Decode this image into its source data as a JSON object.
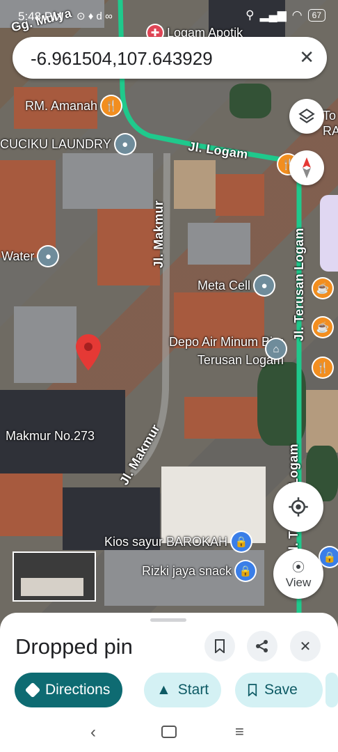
{
  "status_bar": {
    "time": "5:48 PM",
    "indicators": "⊙ ♦ d ∞",
    "battery": "67"
  },
  "search": {
    "query": "-6.961504,107.643929"
  },
  "map": {
    "roads": [
      {
        "label": "Gg. Mulya"
      },
      {
        "label": "Jl. Logam"
      },
      {
        "label": "Jl. Makmur"
      },
      {
        "label": "Jl. Terusan Logam"
      },
      {
        "label": "Jl. Makmur"
      },
      {
        "label": "Jl. Terusan Logam"
      }
    ],
    "pois": [
      {
        "label": "Logam Apotik",
        "icon": "pharmacy-icon",
        "color": "#e04556"
      },
      {
        "label": "RM. Amanah",
        "icon": "restaurant-icon",
        "color": "#f28e1f"
      },
      {
        "label": "CUCIKU LAUNDRY",
        "icon": "place-icon",
        "color": "#6f8c9b"
      },
      {
        "label": "Water",
        "icon": "place-icon",
        "color": "#6f8c9b"
      },
      {
        "label": "Meta Cell",
        "icon": "place-icon",
        "color": "#6f8c9b"
      },
      {
        "label": "Depo Air Minum Biru Terusan Logam",
        "icon": "bank-icon",
        "color": "#6f8c9b"
      },
      {
        "label": "Makmur No.273",
        "icon": "",
        "color": ""
      },
      {
        "label": "Kios sayur BAROKAH",
        "icon": "shopping-icon",
        "color": "#3a7ee8"
      },
      {
        "label": "Rizki jaya snack",
        "icon": "shopping-icon",
        "color": "#3a7ee8"
      },
      {
        "label": "To RA",
        "icon": "",
        "color": ""
      }
    ]
  },
  "buttons": {
    "view_label": "View"
  },
  "sheet": {
    "title": "Dropped pin",
    "chips": [
      {
        "label": "Directions"
      },
      {
        "label": "Start"
      },
      {
        "label": "Save"
      }
    ]
  },
  "colors": {
    "road_green": "#1fc98c",
    "pin_red": "#e53935",
    "primary": "#0e6b72"
  }
}
